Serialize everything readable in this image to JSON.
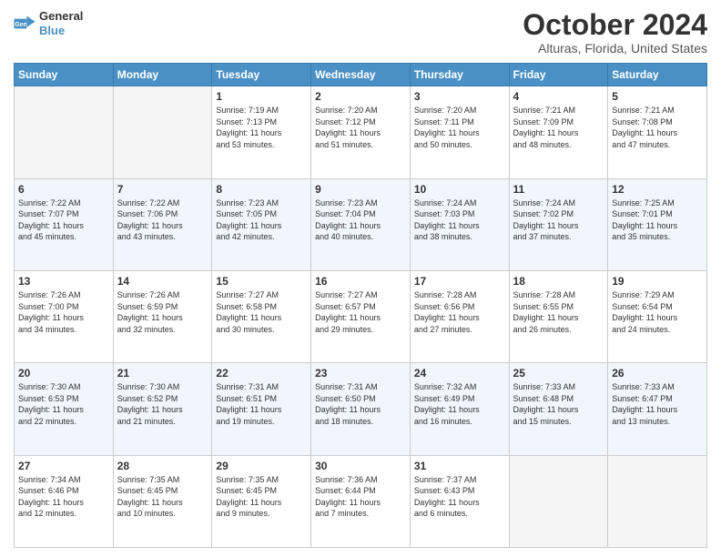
{
  "header": {
    "logo_line1": "General",
    "logo_line2": "Blue",
    "month": "October 2024",
    "location": "Alturas, Florida, United States"
  },
  "days_of_week": [
    "Sunday",
    "Monday",
    "Tuesday",
    "Wednesday",
    "Thursday",
    "Friday",
    "Saturday"
  ],
  "weeks": [
    [
      {
        "day": "",
        "info": ""
      },
      {
        "day": "",
        "info": ""
      },
      {
        "day": "1",
        "info": "Sunrise: 7:19 AM\nSunset: 7:13 PM\nDaylight: 11 hours\nand 53 minutes."
      },
      {
        "day": "2",
        "info": "Sunrise: 7:20 AM\nSunset: 7:12 PM\nDaylight: 11 hours\nand 51 minutes."
      },
      {
        "day": "3",
        "info": "Sunrise: 7:20 AM\nSunset: 7:11 PM\nDaylight: 11 hours\nand 50 minutes."
      },
      {
        "day": "4",
        "info": "Sunrise: 7:21 AM\nSunset: 7:09 PM\nDaylight: 11 hours\nand 48 minutes."
      },
      {
        "day": "5",
        "info": "Sunrise: 7:21 AM\nSunset: 7:08 PM\nDaylight: 11 hours\nand 47 minutes."
      }
    ],
    [
      {
        "day": "6",
        "info": "Sunrise: 7:22 AM\nSunset: 7:07 PM\nDaylight: 11 hours\nand 45 minutes."
      },
      {
        "day": "7",
        "info": "Sunrise: 7:22 AM\nSunset: 7:06 PM\nDaylight: 11 hours\nand 43 minutes."
      },
      {
        "day": "8",
        "info": "Sunrise: 7:23 AM\nSunset: 7:05 PM\nDaylight: 11 hours\nand 42 minutes."
      },
      {
        "day": "9",
        "info": "Sunrise: 7:23 AM\nSunset: 7:04 PM\nDaylight: 11 hours\nand 40 minutes."
      },
      {
        "day": "10",
        "info": "Sunrise: 7:24 AM\nSunset: 7:03 PM\nDaylight: 11 hours\nand 38 minutes."
      },
      {
        "day": "11",
        "info": "Sunrise: 7:24 AM\nSunset: 7:02 PM\nDaylight: 11 hours\nand 37 minutes."
      },
      {
        "day": "12",
        "info": "Sunrise: 7:25 AM\nSunset: 7:01 PM\nDaylight: 11 hours\nand 35 minutes."
      }
    ],
    [
      {
        "day": "13",
        "info": "Sunrise: 7:26 AM\nSunset: 7:00 PM\nDaylight: 11 hours\nand 34 minutes."
      },
      {
        "day": "14",
        "info": "Sunrise: 7:26 AM\nSunset: 6:59 PM\nDaylight: 11 hours\nand 32 minutes."
      },
      {
        "day": "15",
        "info": "Sunrise: 7:27 AM\nSunset: 6:58 PM\nDaylight: 11 hours\nand 30 minutes."
      },
      {
        "day": "16",
        "info": "Sunrise: 7:27 AM\nSunset: 6:57 PM\nDaylight: 11 hours\nand 29 minutes."
      },
      {
        "day": "17",
        "info": "Sunrise: 7:28 AM\nSunset: 6:56 PM\nDaylight: 11 hours\nand 27 minutes."
      },
      {
        "day": "18",
        "info": "Sunrise: 7:28 AM\nSunset: 6:55 PM\nDaylight: 11 hours\nand 26 minutes."
      },
      {
        "day": "19",
        "info": "Sunrise: 7:29 AM\nSunset: 6:54 PM\nDaylight: 11 hours\nand 24 minutes."
      }
    ],
    [
      {
        "day": "20",
        "info": "Sunrise: 7:30 AM\nSunset: 6:53 PM\nDaylight: 11 hours\nand 22 minutes."
      },
      {
        "day": "21",
        "info": "Sunrise: 7:30 AM\nSunset: 6:52 PM\nDaylight: 11 hours\nand 21 minutes."
      },
      {
        "day": "22",
        "info": "Sunrise: 7:31 AM\nSunset: 6:51 PM\nDaylight: 11 hours\nand 19 minutes."
      },
      {
        "day": "23",
        "info": "Sunrise: 7:31 AM\nSunset: 6:50 PM\nDaylight: 11 hours\nand 18 minutes."
      },
      {
        "day": "24",
        "info": "Sunrise: 7:32 AM\nSunset: 6:49 PM\nDaylight: 11 hours\nand 16 minutes."
      },
      {
        "day": "25",
        "info": "Sunrise: 7:33 AM\nSunset: 6:48 PM\nDaylight: 11 hours\nand 15 minutes."
      },
      {
        "day": "26",
        "info": "Sunrise: 7:33 AM\nSunset: 6:47 PM\nDaylight: 11 hours\nand 13 minutes."
      }
    ],
    [
      {
        "day": "27",
        "info": "Sunrise: 7:34 AM\nSunset: 6:46 PM\nDaylight: 11 hours\nand 12 minutes."
      },
      {
        "day": "28",
        "info": "Sunrise: 7:35 AM\nSunset: 6:45 PM\nDaylight: 11 hours\nand 10 minutes."
      },
      {
        "day": "29",
        "info": "Sunrise: 7:35 AM\nSunset: 6:45 PM\nDaylight: 11 hours\nand 9 minutes."
      },
      {
        "day": "30",
        "info": "Sunrise: 7:36 AM\nSunset: 6:44 PM\nDaylight: 11 hours\nand 7 minutes."
      },
      {
        "day": "31",
        "info": "Sunrise: 7:37 AM\nSunset: 6:43 PM\nDaylight: 11 hours\nand 6 minutes."
      },
      {
        "day": "",
        "info": ""
      },
      {
        "day": "",
        "info": ""
      }
    ]
  ]
}
